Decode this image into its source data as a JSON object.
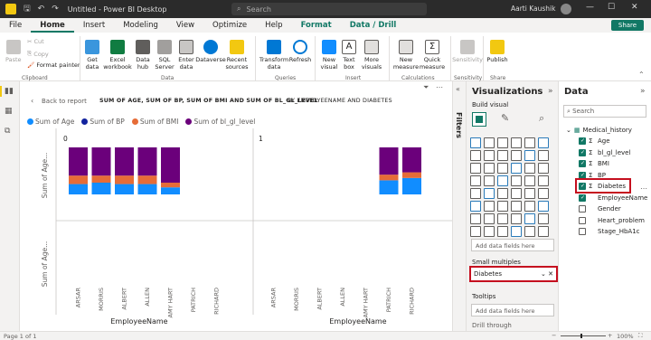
{
  "titlebar": {
    "title": "Untitled - Power BI Desktop",
    "search_placeholder": "Search",
    "user": "Aarti Kaushik"
  },
  "menu": {
    "tabs": [
      "File",
      "Home",
      "Insert",
      "Modeling",
      "View",
      "Optimize",
      "Help",
      "Format",
      "Data / Drill"
    ],
    "share": "Share"
  },
  "ribbon": {
    "clipboard": {
      "paste": "Paste",
      "cut": "Cut",
      "copy": "Copy",
      "format_painter": "Format painter",
      "group": "Clipboard"
    },
    "data": {
      "get_data": "Get data",
      "excel": "Excel workbook",
      "data_hub": "Data hub",
      "sql": "SQL Server",
      "enter_data": "Enter data",
      "dataverse": "Dataverse",
      "recent": "Recent sources",
      "group": "Data"
    },
    "queries": {
      "transform": "Transform data",
      "refresh": "Refresh",
      "group": "Queries"
    },
    "insert": {
      "new_visual": "New visual",
      "text_box": "Text box",
      "more_visuals": "More visuals",
      "group": "Insert"
    },
    "calculations": {
      "new_measure": "New measure",
      "quick_measure": "Quick measure",
      "group": "Calculations"
    },
    "sensitivity": {
      "label": "Sensitivity",
      "group": "Sensitivity"
    },
    "share": {
      "publish": "Publish",
      "group": "Share"
    }
  },
  "report": {
    "back": "Back to report",
    "title": "SUM OF AGE, SUM OF BP, SUM OF BMI AND SUM OF BL_GL_LEVEL",
    "by": "BY EMPLOYEENAME AND DIABETES",
    "panel_labels": [
      "0",
      "1"
    ],
    "y_label": "Sum of Age...",
    "x_label": "EmployeeName"
  },
  "chart_data": {
    "type": "bar",
    "stacked": true,
    "small_multiples_by": "Diabetes",
    "legend": [
      "Sum of Age",
      "Sum of BP",
      "Sum of BMI",
      "Sum of bl_gl_level"
    ],
    "colors": [
      "#118dff",
      "#e66c37",
      "#6b007b",
      "#6b007b"
    ],
    "panels": [
      {
        "label": "0",
        "categories": [
          "ARSAR",
          "MORRIS",
          "ALBERT",
          "ALLEN",
          "AMY HART",
          "PATRICH",
          "RICHARD"
        ],
        "series": [
          {
            "name": "Sum of Age",
            "values": [
              0.22,
              0.25,
              0.22,
              0.22,
              0.15,
              0,
              0
            ]
          },
          {
            "name": "Sum of BP",
            "values": [
              0.18,
              0.15,
              0.18,
              0.18,
              0.1,
              0,
              0
            ]
          },
          {
            "name": "Sum of BMI",
            "values": [
              0.0,
              0.0,
              0.0,
              0.0,
              0.0,
              0,
              0
            ]
          },
          {
            "name": "Sum of bl_gl_level",
            "values": [
              0.6,
              0.6,
              0.6,
              0.6,
              0.75,
              0,
              0
            ]
          }
        ]
      },
      {
        "label": "1",
        "categories": [
          "ARSAR",
          "MORRIS",
          "ALBERT",
          "ALLEN",
          "AMY HART",
          "PATRICH",
          "RICHARD"
        ],
        "series": [
          {
            "name": "Sum of Age",
            "values": [
              0,
              0,
              0,
              0,
              0,
              0.3,
              0.35
            ]
          },
          {
            "name": "Sum of BP",
            "values": [
              0,
              0,
              0,
              0,
              0,
              0.12,
              0.12
            ]
          },
          {
            "name": "Sum of BMI",
            "values": [
              0,
              0,
              0,
              0,
              0,
              0.0,
              0.0
            ]
          },
          {
            "name": "Sum of bl_gl_level",
            "values": [
              0,
              0,
              0,
              0,
              0,
              0.58,
              0.53
            ]
          }
        ]
      }
    ]
  },
  "filters": {
    "label": "Filters"
  },
  "visualizations": {
    "title": "Visualizations",
    "build": "Build visual",
    "add_fields_1": "Add data fields here",
    "small_multiples_label": "Small multiples",
    "small_multiples_value": "Diabetes",
    "tooltips_label": "Tooltips",
    "add_fields_2": "Add data fields here",
    "drill": "Drill through"
  },
  "data_pane": {
    "title": "Data",
    "search": "Search",
    "table": "Medical_history",
    "fields": [
      {
        "name": "Age",
        "checked": true,
        "sigma": true
      },
      {
        "name": "bl_gl_level",
        "checked": true,
        "sigma": true
      },
      {
        "name": "BMI",
        "checked": true,
        "sigma": true
      },
      {
        "name": "BP",
        "checked": true,
        "sigma": true
      },
      {
        "name": "Diabetes",
        "checked": true,
        "sigma": true
      },
      {
        "name": "EmployeeName",
        "checked": true,
        "sigma": false
      },
      {
        "name": "Gender",
        "checked": false,
        "sigma": false
      },
      {
        "name": "Heart_problem",
        "checked": false,
        "sigma": false
      },
      {
        "name": "Stage_HbA1c",
        "checked": false,
        "sigma": false
      }
    ]
  },
  "status": {
    "page": "Page 1 of 1",
    "zoom": "100%"
  }
}
